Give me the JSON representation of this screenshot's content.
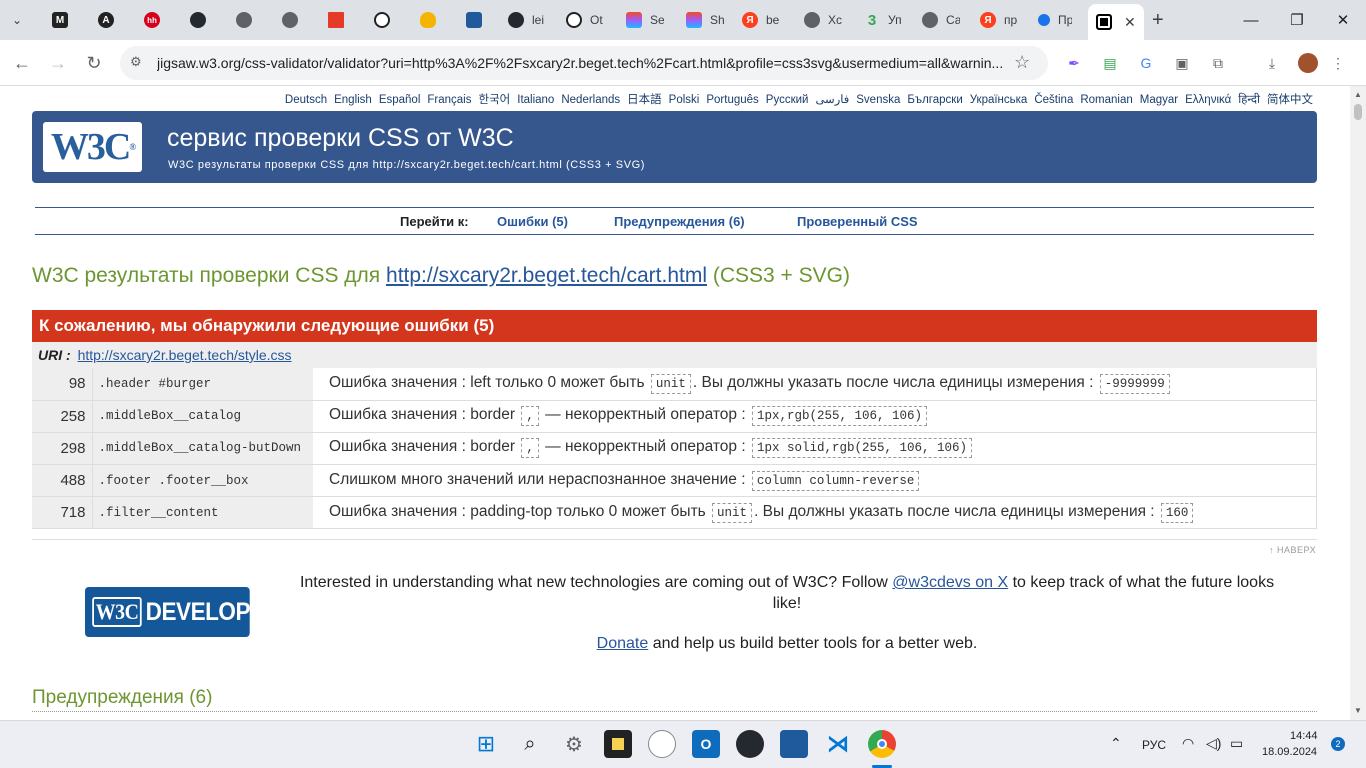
{
  "browser": {
    "tabs": [
      {
        "icon": "M",
        "label": ""
      },
      {
        "icon": "A",
        "label": ""
      },
      {
        "icon": "hh",
        "label": ""
      },
      {
        "icon": "gh",
        "label": ""
      },
      {
        "icon": "globe",
        "label": ""
      },
      {
        "icon": "globe",
        "label": ""
      },
      {
        "icon": "red",
        "label": ""
      },
      {
        "icon": "openai",
        "label": ""
      },
      {
        "icon": "cloud",
        "label": ""
      },
      {
        "icon": "vs",
        "label": ""
      },
      {
        "icon": "gh",
        "label": "lei"
      },
      {
        "icon": "openai",
        "label": "Ot"
      },
      {
        "icon": "figma",
        "label": "Se"
      },
      {
        "icon": "figma",
        "label": "Sh"
      },
      {
        "icon": "ya",
        "label": "be"
      },
      {
        "icon": "globe",
        "label": "Xc"
      },
      {
        "icon": "3",
        "label": "Уп"
      },
      {
        "icon": "globe",
        "label": "Са"
      },
      {
        "icon": "ya",
        "label": "пр"
      },
      {
        "icon": "dot",
        "label": "Пр"
      }
    ],
    "active_tab_icon": "w3c-validator",
    "new_tab_label": "+",
    "url": "jigsaw.w3.org/css-validator/validator?uri=http%3A%2F%2Fsxcary2r.beget.tech%2Fcart.html&profile=css3svg&usermedium=all&warnin..."
  },
  "page": {
    "languages": [
      "Deutsch",
      "English",
      "Español",
      "Français",
      "한국어",
      "Italiano",
      "Nederlands",
      "日本語",
      "Polski",
      "Português",
      "Русский",
      "فارسی",
      "Svenska",
      "Български",
      "Українська",
      "Čeština",
      "Romanian",
      "Magyar",
      "Ελληνικά",
      "हिन्दी",
      "简体中文"
    ],
    "banner": {
      "logo": "W3C",
      "title": "сервис проверки CSS от W3C",
      "subtitle": "W3C результаты проверки CSS для http://sxcary2r.beget.tech/cart.html (CSS3 + SVG)"
    },
    "jump": {
      "label": "Перейти к:",
      "errors": "Ошибки (5)",
      "warnings": "Предупреждения (6)",
      "validated": "Проверенный CSS"
    },
    "results_heading": {
      "prefix": "W3C результаты проверки CSS для ",
      "link": "http://sxcary2r.beget.tech/cart.html",
      "suffix": " (CSS3 + SVG)"
    },
    "errors_title": "К сожалению, мы обнаружили следующие ошибки (5)",
    "uri_label": "URI :",
    "uri_link": "http://sxcary2r.beget.tech/style.css",
    "errors": [
      {
        "line": "98",
        "context": ".header #burger",
        "parts": [
          "Ошибка значения : left только 0 может быть ",
          "unit",
          ". Вы должны указать после числа единицы измерения : ",
          "-9999999"
        ]
      },
      {
        "line": "258",
        "context": ".middleBox__catalog",
        "parts": [
          "Ошибка значения : border ",
          ",",
          " — некорректный оператор : ",
          "1px,rgb(255, 106, 106)"
        ]
      },
      {
        "line": "298",
        "context": ".middleBox__catalog-butDown",
        "parts": [
          "Ошибка значения : border ",
          ",",
          " — некорректный оператор : ",
          "1px solid,rgb(255, 106, 106)"
        ]
      },
      {
        "line": "488",
        "context": ".footer .footer__box",
        "parts": [
          "Слишком много значений или нераспознанное значение : ",
          "column column-reverse"
        ]
      },
      {
        "line": "718",
        "context": ".filter__content",
        "parts": [
          "Ошибка значения : padding-top только 0 может быть ",
          "unit",
          ". Вы должны указать после числа единицы измерения : ",
          "160"
        ]
      }
    ],
    "back_to_top": "↑ НАВЕРХ",
    "developers": {
      "logo_w3c": "W3C",
      "logo_text": "DEVELOPERS",
      "text_before": "Interested in understanding what new technologies are coming out of W3C? Follow ",
      "link": "@w3cdevs on X",
      "text_after": " to keep track of what the future looks like!",
      "donate_link": "Donate",
      "donate_text": " and help us build better tools for a better web."
    },
    "warnings_heading": "Предупреждения (6)"
  },
  "taskbar": {
    "lang": "РУС",
    "time": "14:44",
    "date": "18.09.2024",
    "notifications": "2"
  }
}
